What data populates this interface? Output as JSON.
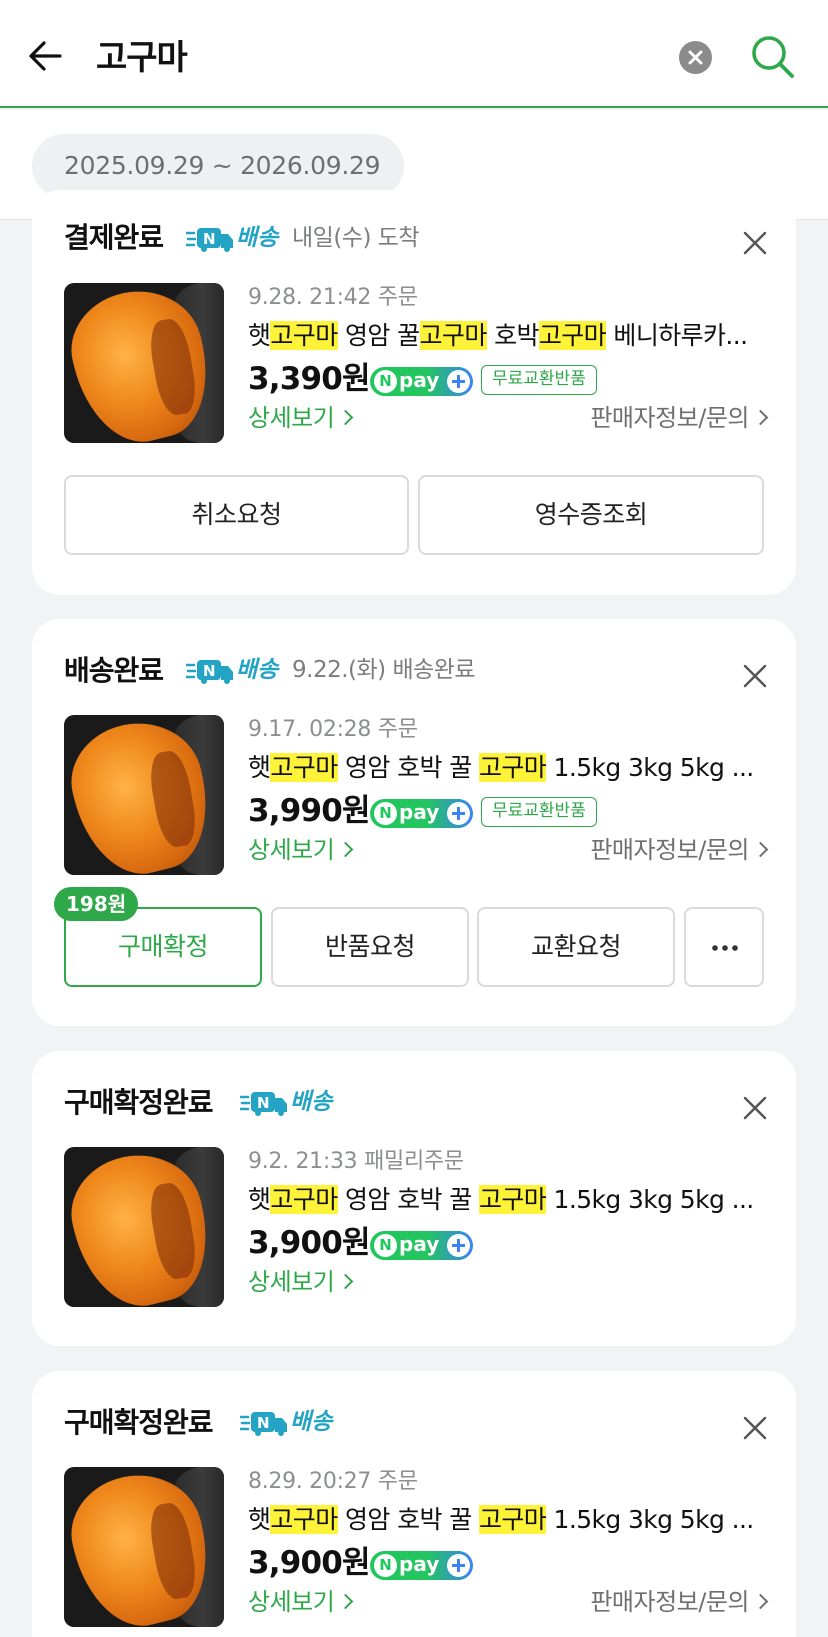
{
  "header": {
    "query": "고구마",
    "back_icon": "back-arrow-icon",
    "clear_icon": "clear-icon",
    "search_icon": "search-icon",
    "accent_color": "#2fa84a"
  },
  "filter": {
    "date_range": "2025.09.29 ~ 2026.09.29"
  },
  "orders": [
    {
      "status": "결제완료",
      "delivery_label": "배송",
      "delivery_info": "내일(수) 도착",
      "order_date": "9.28. 21:42 주문",
      "title_parts": [
        "햇",
        "고구마",
        " 영암 꿀",
        "고구마",
        " 호박",
        "고구마",
        " 베니하루카..."
      ],
      "price": "3,390원",
      "npay": "pay",
      "badge": "무료교환반품",
      "detail_link": "상세보기",
      "seller_link": "판매자정보/문의",
      "buttons": [
        "취소요청",
        "영수증조회"
      ]
    },
    {
      "status": "배송완료",
      "delivery_label": "배송",
      "delivery_info": "9.22.(화) 배송완료",
      "order_date": "9.17. 02:28 주문",
      "title_parts": [
        "햇",
        "고구마",
        " 영암 호박 꿀 ",
        "고구마",
        " 1.5kg 3kg 5kg ..."
      ],
      "price": "3,990원",
      "npay": "pay",
      "badge": "무료교환반품",
      "detail_link": "상세보기",
      "seller_link": "판매자정보/문의",
      "reward_bubble": "198원",
      "buttons": [
        "구매확정",
        "반품요청",
        "교환요청"
      ],
      "more_icon": "more-icon"
    },
    {
      "status": "구매확정완료",
      "delivery_label": "배송",
      "delivery_info": "",
      "order_date": "9.2. 21:33 패밀리주문",
      "title_parts": [
        "햇",
        "고구마",
        " 영암 호박 꿀 ",
        "고구마",
        " 1.5kg 3kg 5kg ..."
      ],
      "price": "3,900원",
      "npay": "pay",
      "detail_link": "상세보기"
    },
    {
      "status": "구매확정완료",
      "delivery_label": "배송",
      "delivery_info": "",
      "order_date": "8.29. 20:27 주문",
      "title_parts": [
        "햇",
        "고구마",
        " 영암 호박 꿀 ",
        "고구마",
        " 1.5kg 3kg 5kg ..."
      ],
      "price": "3,900원",
      "npay": "pay",
      "detail_link": "상세보기",
      "seller_link": "판매자정보/문의"
    }
  ]
}
